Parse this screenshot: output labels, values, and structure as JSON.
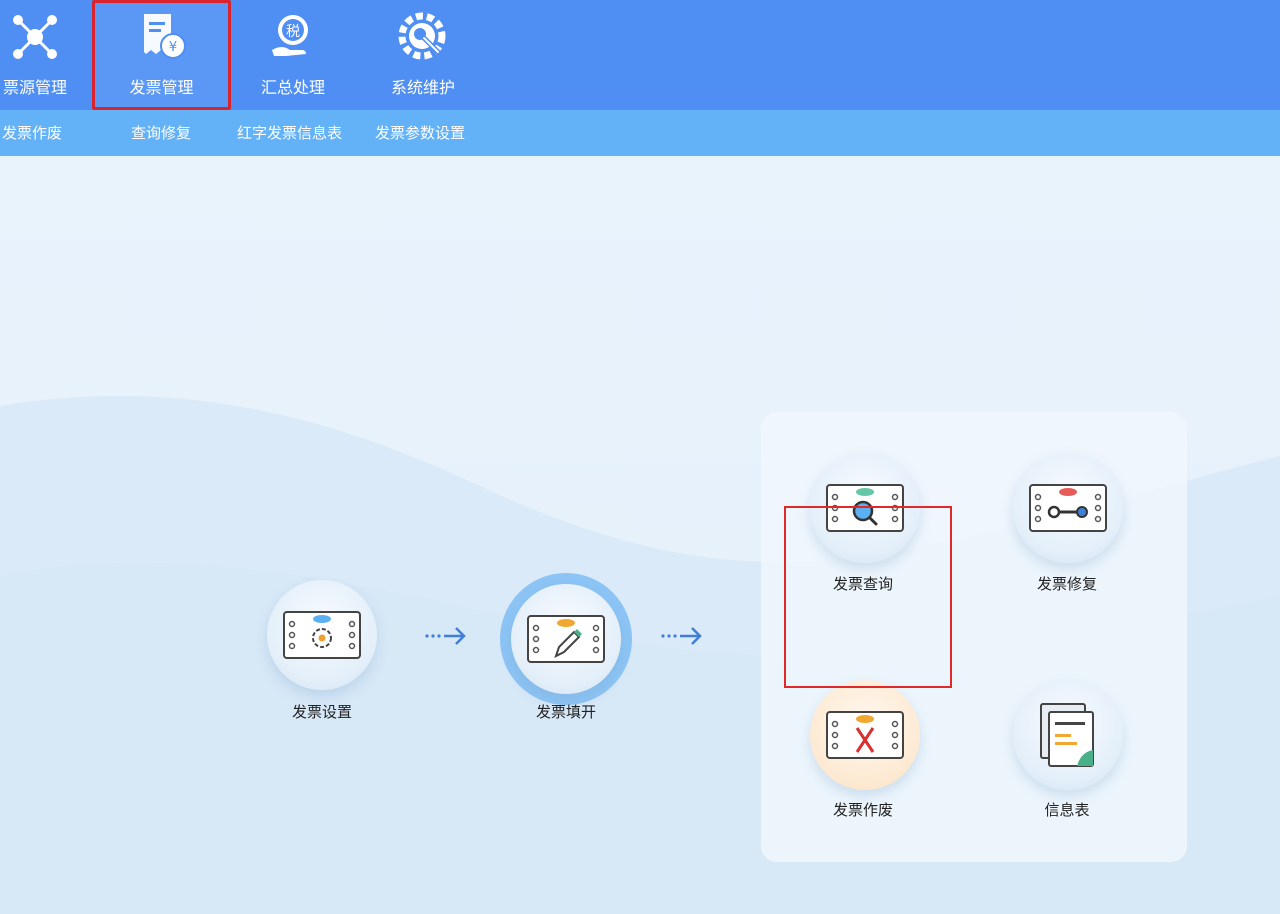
{
  "toolbar": {
    "items": [
      {
        "label": "票源管理",
        "icon": "network-icon"
      },
      {
        "label": "发票管理",
        "icon": "invoice-yen-icon",
        "selected": true
      },
      {
        "label": "汇总处理",
        "icon": "tax-hand-icon"
      },
      {
        "label": "系统维护",
        "icon": "gear-wrench-icon"
      }
    ]
  },
  "subbar": {
    "items": [
      "发票作废",
      "查询修复",
      "红字发票信息表",
      "发票参数设置"
    ]
  },
  "workflow": {
    "invoice_settings": "发票设置",
    "invoice_fill": "发票填开",
    "invoice_query": "发票查询",
    "invoice_repair": "发票修复",
    "invoice_void": "发票作废",
    "info_table": "信息表"
  },
  "colors": {
    "toolbar_bg": "#4f8ef2",
    "subbar_bg": "#63b2f8",
    "highlight": "#e02a2a",
    "arrow": "#3f7fd6"
  }
}
